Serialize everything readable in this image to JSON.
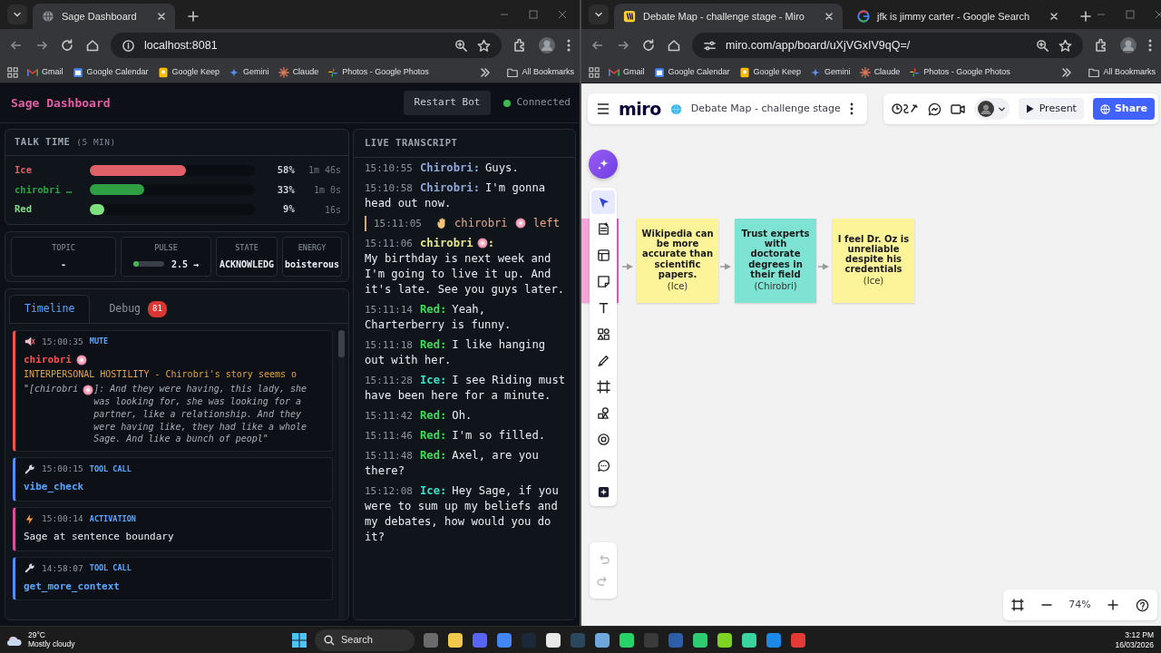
{
  "browsers": [
    {
      "tabs": [
        {
          "kind": "globe",
          "title": "Sage Dashboard",
          "selected": true
        }
      ],
      "url": "localhost:8081",
      "bookmarks": [
        {
          "kind": "gmail",
          "label": "Gmail"
        },
        {
          "kind": "calendar",
          "label": "Google Calendar"
        },
        {
          "kind": "keep",
          "label": "Google Keep"
        },
        {
          "kind": "gemini",
          "label": "Gemini"
        },
        {
          "kind": "claude",
          "label": "Claude"
        },
        {
          "kind": "photos",
          "label": "Photos - Google Photos"
        }
      ],
      "all_bookmarks": "All Bookmarks"
    },
    {
      "tabs": [
        {
          "kind": "miro",
          "title": "Debate Map - challenge stage - Miro",
          "selected": true
        },
        {
          "kind": "google",
          "title": "jfk is jimmy carter - Google Search",
          "selected": false
        }
      ],
      "url": "miro.com/app/board/uXjVGxIV9qQ=/",
      "bookmarks": [
        {
          "kind": "gmail",
          "label": "Gmail"
        },
        {
          "kind": "calendar",
          "label": "Google Calendar"
        },
        {
          "kind": "keep",
          "label": "Google Keep"
        },
        {
          "kind": "gemini",
          "label": "Gemini"
        },
        {
          "kind": "claude",
          "label": "Claude"
        },
        {
          "kind": "photos",
          "label": "Photos - Google Photos"
        }
      ],
      "all_bookmarks": "All Bookmarks"
    }
  ],
  "dashboard": {
    "title": "Sage Dashboard",
    "restart_button": "Restart Bot",
    "connection": {
      "label": "Connected",
      "connected": true
    },
    "talk_time": {
      "title": "TALK TIME",
      "subtitle": "(5 MIN)",
      "speakers": [
        {
          "name": "Ice",
          "color": "#e0606a",
          "level": 0.58,
          "percent": "58%",
          "duration": "1m 46s"
        },
        {
          "name": "chirobri …",
          "color": "#2ea043",
          "level": 0.33,
          "percent": "33%",
          "duration": "1m 0s"
        },
        {
          "name": "Red",
          "color": "#7ee07e",
          "level": 0.09,
          "percent": "9%",
          "duration": "16s"
        }
      ]
    },
    "stats": [
      {
        "kind": "text",
        "label": "TOPIC",
        "value": "-"
      },
      {
        "kind": "meter",
        "label": "PULSE",
        "value": "2.5 →",
        "level": 0.08
      },
      {
        "kind": "text",
        "label": "STATE",
        "value": "ACKNOWLEDG"
      },
      {
        "kind": "text",
        "label": "ENERGY",
        "value": "boisterous"
      }
    ],
    "tabs": [
      {
        "label": "Timeline",
        "selected": true
      },
      {
        "label": "Debug",
        "badge": "81",
        "selected": false
      }
    ],
    "timeline": [
      {
        "kind": "mute",
        "time": "15:00:35",
        "type": "MUTE",
        "speaker": "chirobri",
        "category": "INTERPERSONAL HOSTILITY - Chirobri's story seems o",
        "quote_open": "\"[chirobri",
        "quote_rest": "]: And they were having, this lady, she was looking for, she was looking for a partner, like a relationship. And they were having like, they had like a whole Sage. And like a bunch of peopl\""
      },
      {
        "kind": "tool",
        "time": "15:00:15",
        "type": "TOOL CALL",
        "body": "vibe_check"
      },
      {
        "kind": "activation",
        "time": "15:00:14",
        "type": "ACTIVATION",
        "body": "Sage at sentence boundary"
      },
      {
        "kind": "tool",
        "time": "14:58:07",
        "type": "TOOL CALL",
        "body": "get_more_context"
      }
    ]
  },
  "transcript": {
    "title": "LIVE TRANSCRIPT",
    "entries": [
      {
        "kind": "line",
        "time": "15:10:55",
        "speaker": "Chirobri:",
        "color": "#8fa6d6",
        "text": "Guys."
      },
      {
        "kind": "line",
        "time": "15:10:58",
        "speaker": "Chirobri:",
        "color": "#8fa6d6",
        "text": "I'm gonna head out now."
      },
      {
        "kind": "leave",
        "time": "15:11:05",
        "speaker": "chirobri",
        "color": "#e8a884",
        "text": "left"
      },
      {
        "kind": "line",
        "time": "15:11:06",
        "speaker": "chirobri",
        "donut": true,
        "speaker_end": ":",
        "color": "#e6e68a",
        "text": "My birthday is next week and I'm going to live it up. And it's late. See you guys later."
      },
      {
        "kind": "line",
        "time": "15:11:14",
        "speaker": "Red:",
        "color": "#3fdc5a",
        "text": "Yeah, Charterberry is funny."
      },
      {
        "kind": "line",
        "time": "15:11:18",
        "speaker": "Red:",
        "color": "#3fdc5a",
        "text": "I like hanging out with her."
      },
      {
        "kind": "line",
        "time": "15:11:28",
        "speaker": "Ice:",
        "color": "#3de0c8",
        "text": "I see Riding must have been here for a minute."
      },
      {
        "kind": "line",
        "time": "15:11:42",
        "speaker": "Red:",
        "color": "#3fdc5a",
        "text": "Oh."
      },
      {
        "kind": "line",
        "time": "15:11:46",
        "speaker": "Red:",
        "color": "#3fdc5a",
        "text": "I'm so filled."
      },
      {
        "kind": "line",
        "time": "15:11:48",
        "speaker": "Red:",
        "color": "#3fdc5a",
        "text": "Axel, are you there?"
      },
      {
        "kind": "line",
        "time": "15:12:08",
        "speaker": "Ice:",
        "color": "#3de0c8",
        "text": "Hey Sage, if you were to sum up my beliefs and my debates, how would you do it?"
      }
    ]
  },
  "miro": {
    "logo": "miro",
    "board_title": "Debate Map - challenge stage",
    "present": "Present",
    "share": "Share",
    "zoom": "74%",
    "tools": [
      {
        "kind": "select",
        "selected": true
      },
      {
        "kind": "template",
        "selected": false
      },
      {
        "kind": "layout",
        "selected": false
      },
      {
        "kind": "sticky",
        "selected": false
      },
      {
        "kind": "text",
        "selected": false
      },
      {
        "kind": "shapes",
        "selected": false
      },
      {
        "kind": "pen",
        "selected": false
      },
      {
        "kind": "frame",
        "selected": false
      },
      {
        "kind": "components",
        "selected": false
      },
      {
        "kind": "emoji",
        "selected": false
      },
      {
        "kind": "comment",
        "selected": false
      },
      {
        "kind": "add",
        "selected": false
      }
    ],
    "stickies": [
      {
        "text": "Wikipedia can be more accurate than scientific papers.",
        "author": "(Ice)",
        "color": "#fdf49a"
      },
      {
        "text": "Trust experts with doctorate degrees in their field",
        "author": "(Chirobri)",
        "color": "#7fe3d4"
      },
      {
        "text": "I feel Dr. Oz is unreliable despite his credentials",
        "author": "(Ice)",
        "color": "#fdf49a"
      }
    ]
  },
  "taskbar": {
    "temperature": "29°C",
    "weather": "Mostly cloudy",
    "search": "Search",
    "time": "3:12 PM",
    "date": "16/03/2026"
  }
}
